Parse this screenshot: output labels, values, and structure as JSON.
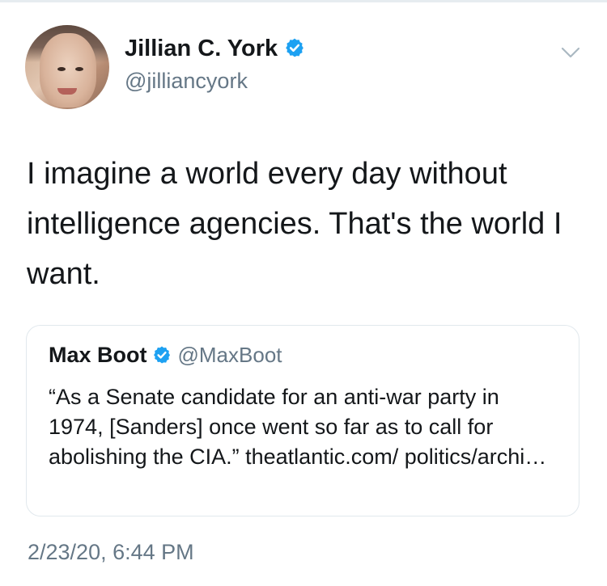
{
  "tweet": {
    "author": {
      "name": "Jillian C. York",
      "handle": "@jilliancyork",
      "verified": true,
      "avatar": "profile-photo"
    },
    "text": "I imagine a world every day without intelligence agencies. That's the world I want.",
    "timestamp": "2/23/20, 6:44 PM",
    "menu_icon": "chevron-down-icon"
  },
  "quoted_tweet": {
    "name": "Max Boot",
    "handle": "@MaxBoot",
    "verified": true,
    "text": "“As a Senate candidate for an anti-war party in 1974, [Sanders] once went so far as to call for abolishing the CIA.” theatlantic.com/ politics/archi…"
  },
  "colors": {
    "verified_blue": "#1DA1F2",
    "secondary_text": "#657786",
    "primary_text": "#14171A",
    "border": "#E1E8ED"
  }
}
